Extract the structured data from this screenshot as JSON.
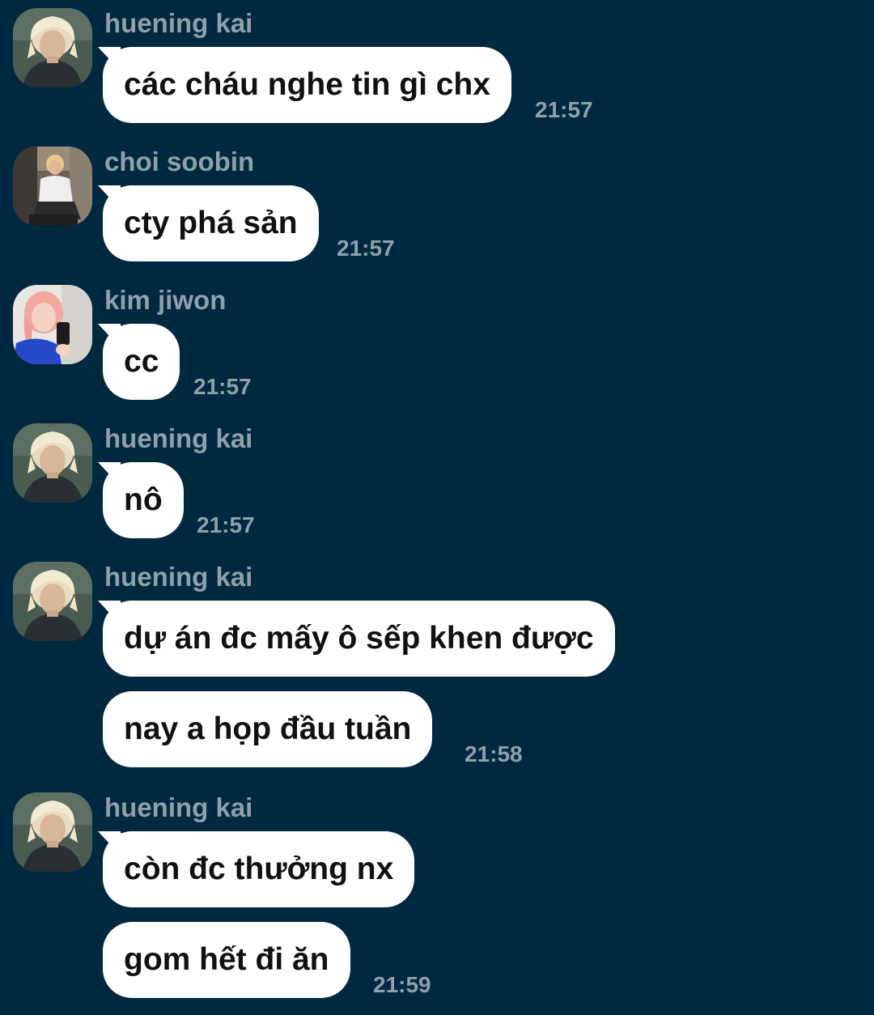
{
  "colors": {
    "background": "#002940",
    "bubble": "#ffffff",
    "message_text": "#111111",
    "meta_text": "#8f9fab"
  },
  "messages": [
    {
      "sender": "huening kai",
      "avatar": "avatar-huening-kai",
      "text": "các cháu nghe tin gì chx",
      "time": "21:57"
    },
    {
      "sender": "choi soobin",
      "avatar": "avatar-choi-soobin",
      "text": "cty phá sản",
      "time": "21:57"
    },
    {
      "sender": "kim jiwon",
      "avatar": "avatar-kim-jiwon",
      "text": "cc",
      "time": "21:57"
    },
    {
      "sender": "huening kai",
      "avatar": "avatar-huening-kai",
      "text": "nô",
      "time": "21:57"
    },
    {
      "sender": "huening kai",
      "avatar": "avatar-huening-kai",
      "text": "dự án đc mấy ô sếp khen được"
    },
    {
      "text": "nay a họp đầu tuần",
      "time": "21:58"
    },
    {
      "sender": "huening kai",
      "avatar": "avatar-huening-kai",
      "text": "còn đc thưởng nx"
    },
    {
      "text": "gom hết đi ăn",
      "time": "21:59"
    }
  ]
}
